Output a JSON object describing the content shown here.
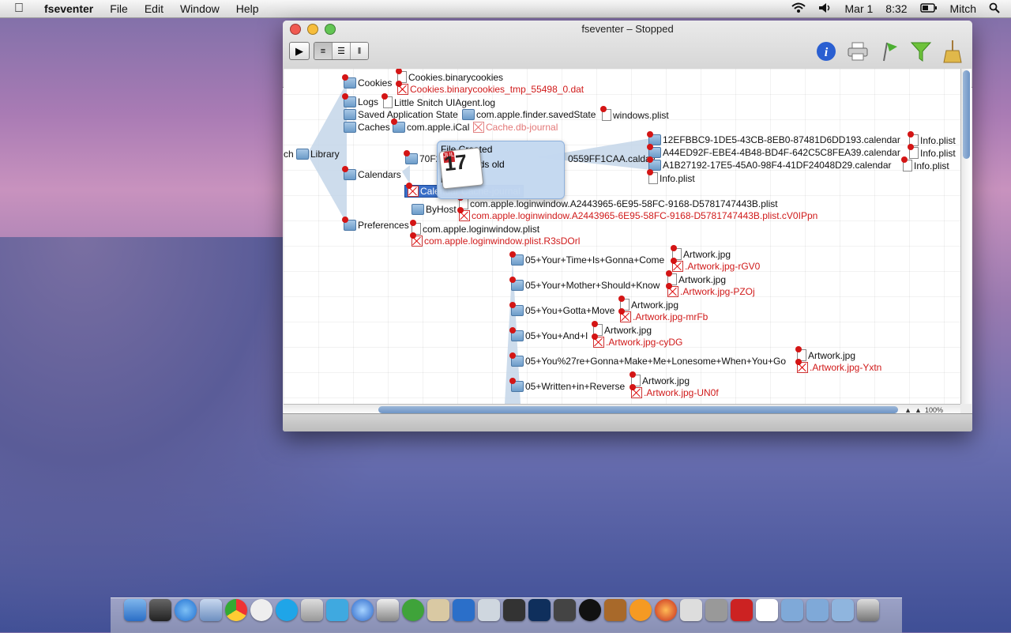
{
  "menubar": {
    "apple": "",
    "app_name": "fseventer",
    "menus": [
      "File",
      "Edit",
      "Window",
      "Help"
    ],
    "date": "Mar 1",
    "time": "8:32",
    "user": "Mitch"
  },
  "window": {
    "title": "fseventer – Stopped",
    "tooltip": {
      "line1": "File Created",
      "line2": "56 seconds old",
      "line3": "iCal",
      "calendar_month": "JUL",
      "calendar_day": "17"
    },
    "zoom": "100%"
  },
  "tree": {
    "root_partial": "ch",
    "library": "Library",
    "cookies": "Cookies",
    "cookies_file1": "Cookies.binarycookies",
    "cookies_file2": "Cookies.binarycookies_tmp_55498_0.dat",
    "logs": "Logs",
    "logs_file": "Little Snitch UIAgent.log",
    "saved_state": "Saved Application State",
    "saved_state_child": "com.apple.finder.savedState",
    "saved_state_file": "windows.plist",
    "caches": "Caches",
    "caches_child": "com.apple.iCal",
    "caches_file": "Cache.db-journal",
    "calendars": "Calendars",
    "caldav_prefix": "70F2",
    "caldav": "0559FF1CAA.caldav",
    "cal1": "12EFBBC9-1DE5-43CB-8EB0-87481D6DD193.calendar",
    "cal2": "A44ED92F-EBE4-4B48-BD4F-642C5C8FEA39.calendar",
    "cal3": "A1B27192-17E5-45A0-98F4-41DF24048D29.calendar",
    "info1": "Info.plist",
    "info2": "Info.plist",
    "info3": "Info.plist",
    "info4": "Info.plist",
    "cache_journal": "Calendar Cache-journal",
    "byhost": "ByHost",
    "byhost_file1": "com.apple.loginwindow.A2443965-6E95-58FC-9168-D5781747443B.plist",
    "byhost_file2": "com.apple.loginwindow.A2443965-6E95-58FC-9168-D5781747443B.plist.cV0IPpn",
    "preferences": "Preferences",
    "pref_file1": "com.apple.loginwindow.plist",
    "pref_file2": "com.apple.loginwindow.plist.R3sDOrl",
    "music": [
      {
        "folder": "05+Your+Time+Is+Gonna+Come",
        "art": "Artwork.jpg",
        "tmp": ".Artwork.jpg-rGV0"
      },
      {
        "folder": "05+Your+Mother+Should+Know",
        "art": "Artwork.jpg",
        "tmp": ".Artwork.jpg-PZOj"
      },
      {
        "folder": "05+You+Gotta+Move",
        "art": "Artwork.jpg",
        "tmp": ".Artwork.jpg-mrFb"
      },
      {
        "folder": "05+You+And+I",
        "art": "Artwork.jpg",
        "tmp": ".Artwork.jpg-cyDG"
      },
      {
        "folder": "05+You%27re+Gonna+Make+Me+Lonesome+When+You+Go",
        "art": "Artwork.jpg",
        "tmp": ".Artwork.jpg-Yxtn"
      },
      {
        "folder": "05+Written+in+Reverse",
        "art": "Artwork.jpg",
        "tmp": ".Artwork.jpg-UN0f"
      }
    ]
  },
  "colors": {
    "deleted_text": "#d01a1a",
    "selection": "#3a6fc8",
    "tooltip_bg": "#c3d8f0"
  },
  "icons": [
    "apple-icon",
    "wifi-icon",
    "volume-icon",
    "battery-icon",
    "spotlight-icon",
    "info-icon",
    "printer-icon",
    "flag-icon",
    "filter-icon",
    "broom-icon"
  ]
}
